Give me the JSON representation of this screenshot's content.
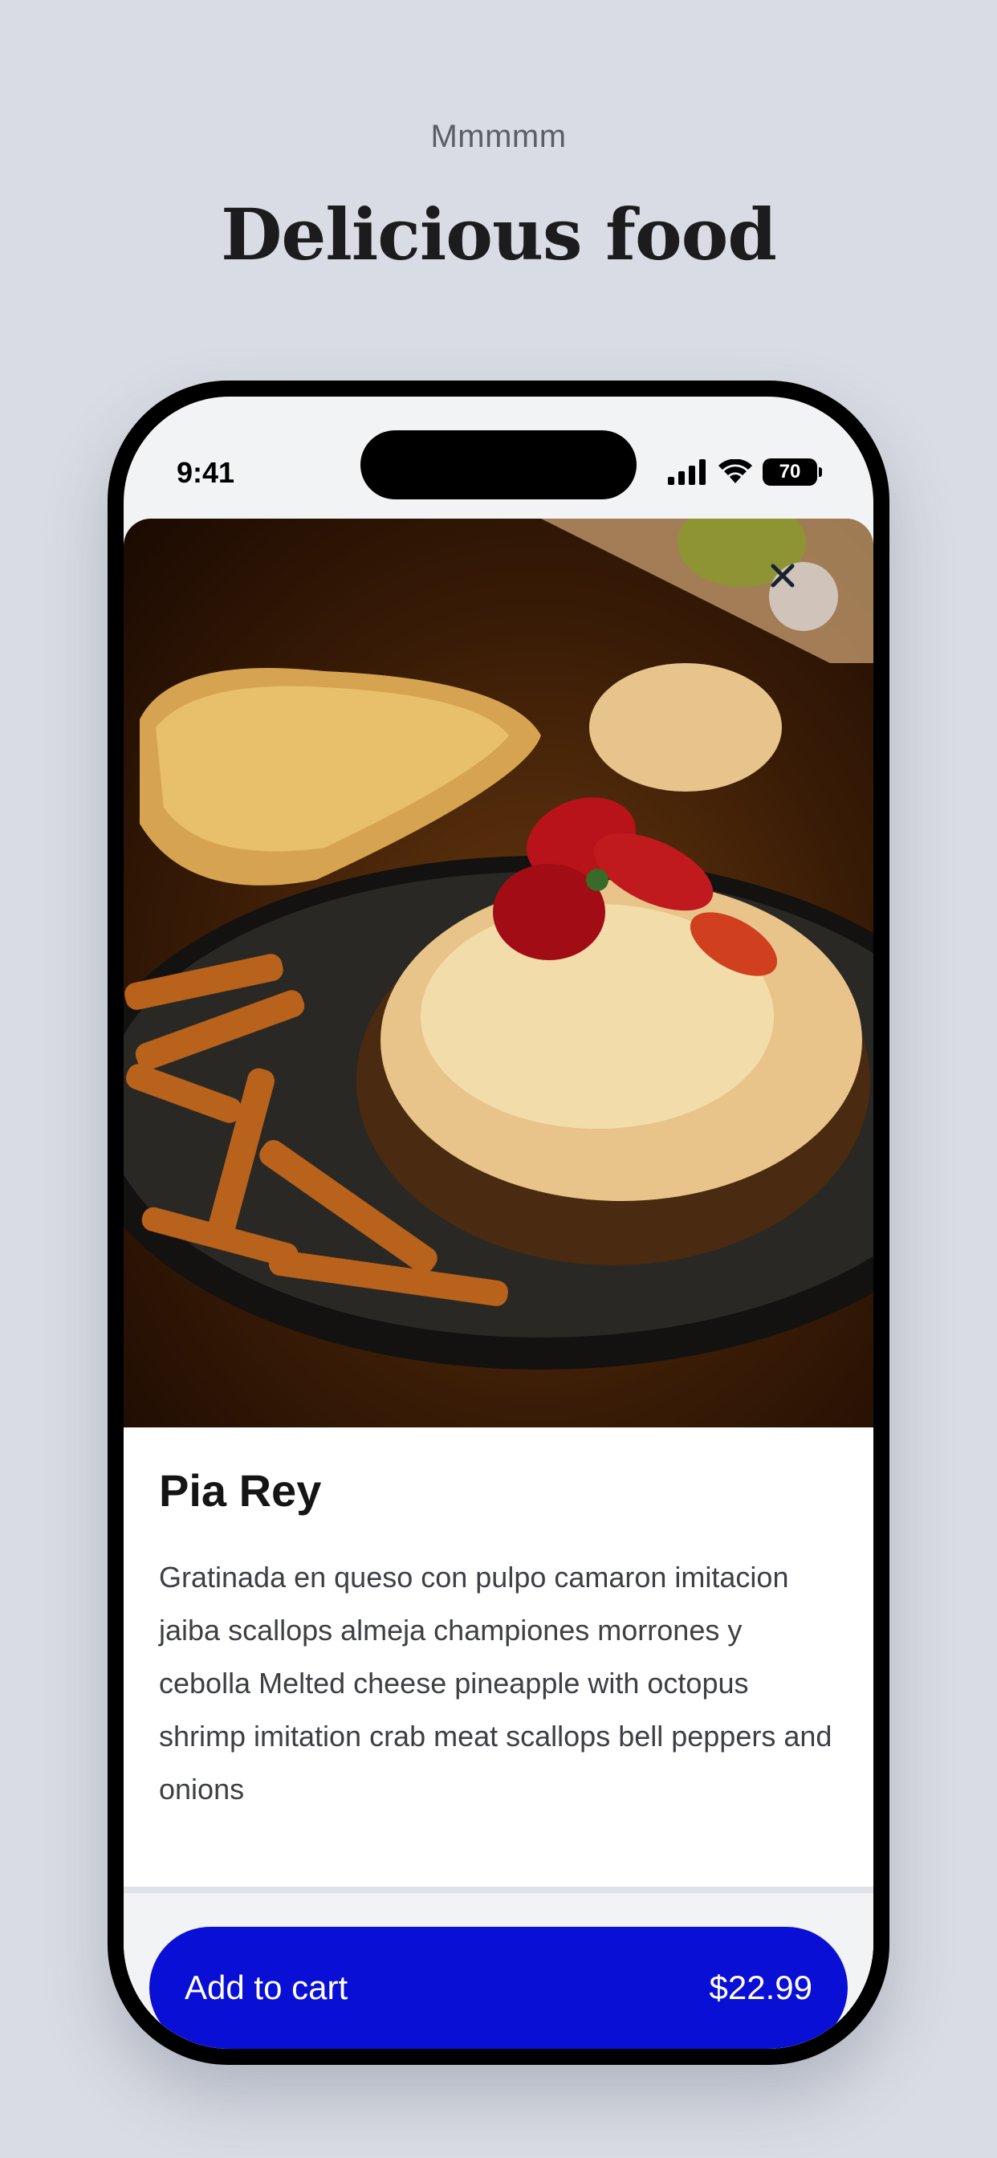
{
  "header": {
    "eyebrow": "Mmmmm",
    "title": "Delicious food"
  },
  "status_bar": {
    "time": "9:41",
    "battery_level": "70",
    "icons": [
      "cellular-signal-icon",
      "wifi-icon",
      "battery-icon"
    ]
  },
  "product": {
    "image_icon": "food-photo",
    "name": "Pia Rey",
    "description": "Gratinada en queso con pulpo camaron imitacion jaiba scallops almeja championes morrones y cebolla Melted cheese pineapple with octopus shrimp imitation crab meat scallops bell peppers and onions"
  },
  "actions": {
    "close_icon": "close-icon",
    "add_to_cart_label": "Add to cart",
    "price": "$22.99"
  },
  "colors": {
    "background": "#d9dce4",
    "accent": "#0a0fd6",
    "text_primary": "#151515"
  }
}
